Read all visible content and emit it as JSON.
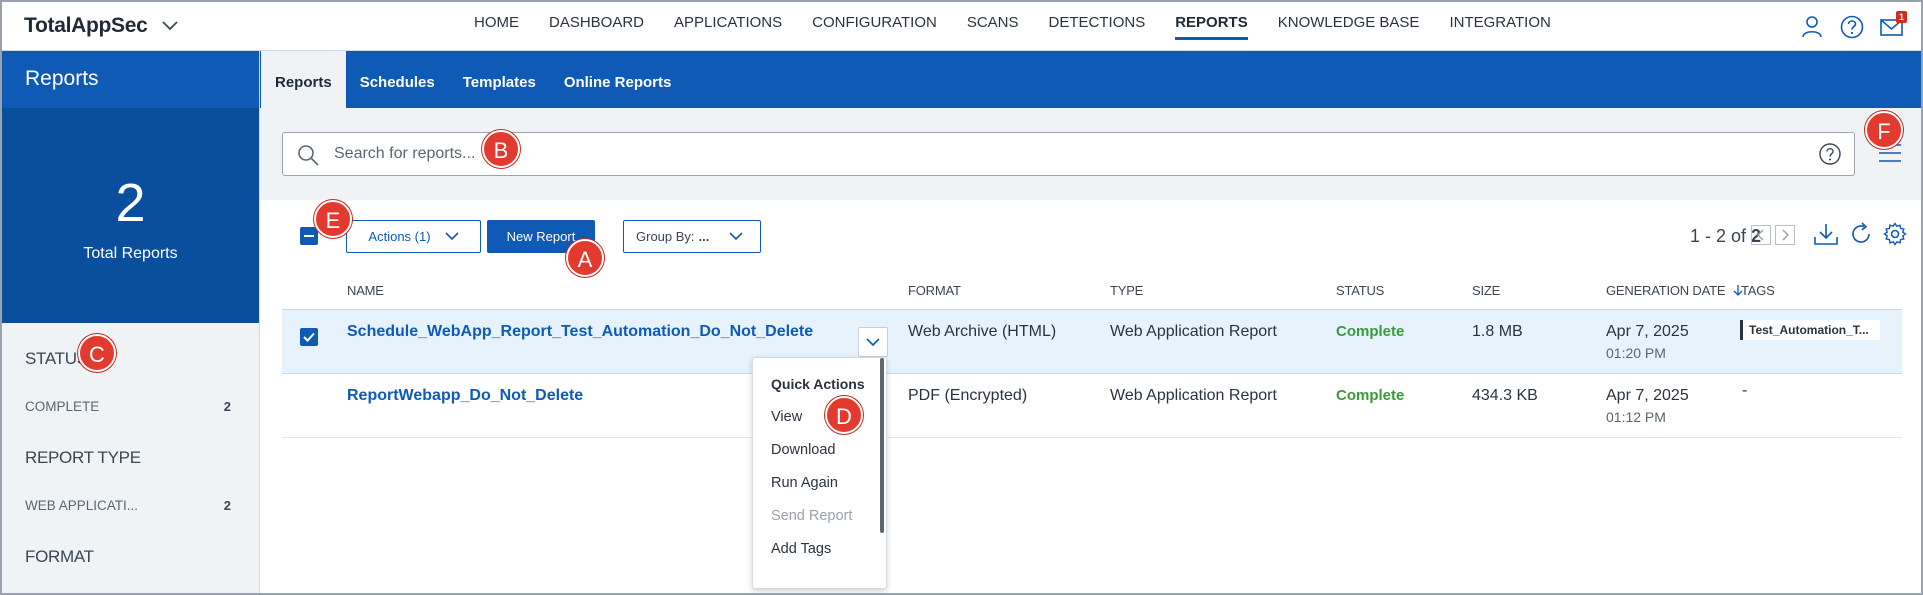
{
  "app": {
    "title": "TotalAppSec"
  },
  "nav": {
    "items": [
      "HOME",
      "DASHBOARD",
      "APPLICATIONS",
      "CONFIGURATION",
      "SCANS",
      "DETECTIONS",
      "REPORTS",
      "KNOWLEDGE BASE",
      "INTEGRATION"
    ],
    "active": "REPORTS",
    "notification_count": "1"
  },
  "sidebar": {
    "title": "Reports",
    "total_count": "2",
    "total_label": "Total Reports",
    "facets": [
      {
        "title": "STATUS",
        "rows": [
          {
            "label": "COMPLETE",
            "count": "2"
          }
        ]
      },
      {
        "title": "REPORT TYPE",
        "rows": [
          {
            "label": "WEB APPLICATI...",
            "count": "2"
          }
        ]
      },
      {
        "title": "FORMAT",
        "rows": []
      }
    ]
  },
  "subtabs": {
    "items": [
      "Reports",
      "Schedules",
      "Templates",
      "Online Reports"
    ],
    "active": "Reports"
  },
  "search": {
    "placeholder": "Search for reports..."
  },
  "toolbar": {
    "actions_label": "Actions (1)",
    "new_report_label": "New Report",
    "group_by_label": "Group By:",
    "group_by_value": "...",
    "pager_range": "1 - 2 of",
    "pager_total": "2"
  },
  "table": {
    "columns": [
      "NAME",
      "FORMAT",
      "TYPE",
      "STATUS",
      "SIZE",
      "GENERATION DATE",
      "TAGS"
    ],
    "rows": [
      {
        "name": "Schedule_WebApp_Report_Test_Automation_Do_Not_Delete",
        "format": "Web Archive (HTML)",
        "type": "Web Application Report",
        "status": "Complete",
        "size": "1.8 MB",
        "date": "Apr 7, 2025",
        "time": "01:20 PM",
        "tag": "Test_Automation_T...",
        "selected": true
      },
      {
        "name": "ReportWebapp_Do_Not_Delete",
        "format": "PDF (Encrypted)",
        "type": "Web Application Report",
        "status": "Complete",
        "size": "434.3 KB",
        "date": "Apr 7, 2025",
        "time": "01:12 PM",
        "tag": "-",
        "selected": false
      }
    ]
  },
  "quick_actions": {
    "title": "Quick Actions",
    "items": [
      {
        "label": "View",
        "disabled": false
      },
      {
        "label": "Download",
        "disabled": false
      },
      {
        "label": "Run Again",
        "disabled": false
      },
      {
        "label": "Send Report",
        "disabled": true
      },
      {
        "label": "Add Tags",
        "disabled": false
      }
    ]
  },
  "markers": [
    "A",
    "B",
    "C",
    "D",
    "E",
    "F"
  ],
  "colors": {
    "primary": "#0f5ab5",
    "primary_dark": "#0a4f9e",
    "complete": "#3a9b3a",
    "marker": "#e23a2e",
    "sidebar_bg": "#f0f3f6"
  }
}
